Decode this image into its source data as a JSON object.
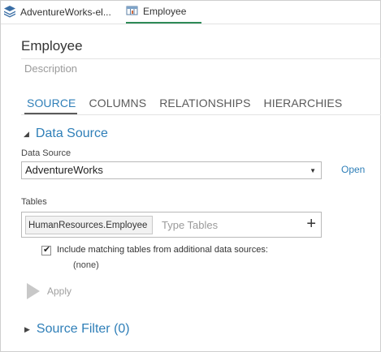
{
  "tabs": [
    {
      "label": "AdventureWorks-el...",
      "icon": "layers-icon"
    },
    {
      "label": "Employee",
      "icon": "table-icon",
      "active": true
    }
  ],
  "page": {
    "title": "Employee",
    "description_placeholder": "Description"
  },
  "subtabs": [
    "SOURCE",
    "COLUMNS",
    "RELATIONSHIPS",
    "HIERARCHIES"
  ],
  "data_source_section": {
    "heading": "Data Source",
    "field_label": "Data Source",
    "selected": "AdventureWorks",
    "open_label": "Open"
  },
  "tables": {
    "label": "Tables",
    "chip": "HumanResources.Employee",
    "placeholder": "Type Tables",
    "add_symbol": "+"
  },
  "include_matching": {
    "label": "Include matching tables from additional data sources:",
    "checked": true,
    "value": "(none)"
  },
  "apply_label": "Apply",
  "source_filter": {
    "heading": "Source Filter (0)"
  },
  "colors": {
    "accent": "#2f7fb8",
    "tab_underline": "#2e8b57"
  }
}
